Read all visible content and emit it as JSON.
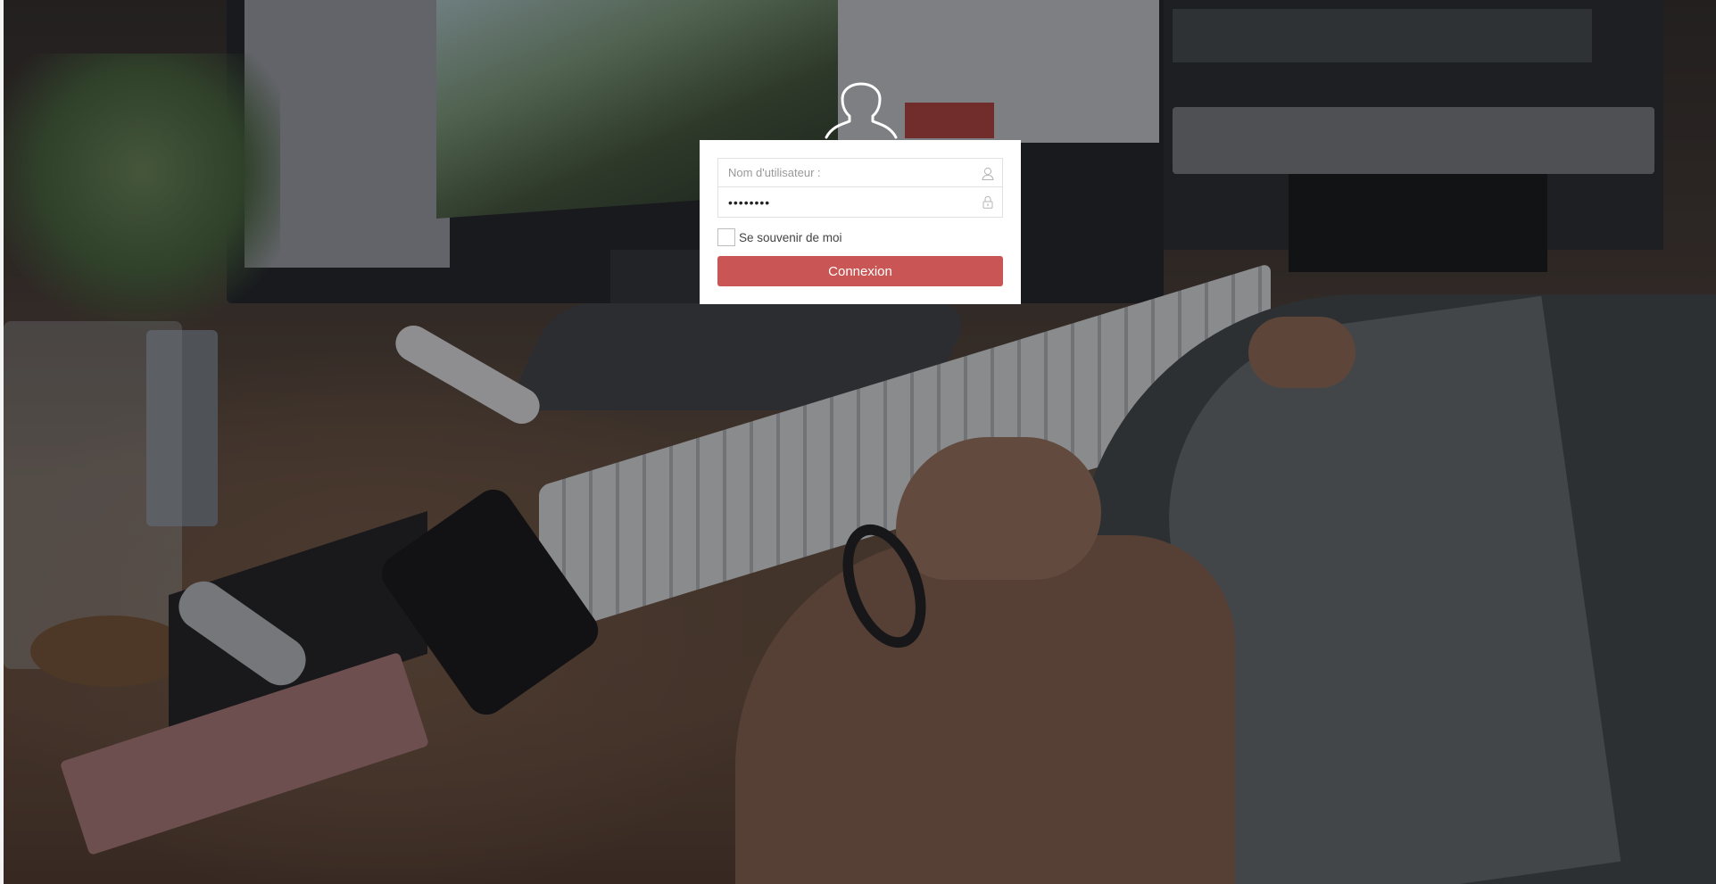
{
  "login": {
    "username_placeholder": "Nom d'utilisateur :",
    "password_value": "••••••••",
    "remember_label": "Se souvenir de moi",
    "remember_checked": false,
    "submit_label": "Connexion"
  },
  "icons": {
    "avatar": "user-silhouette-icon",
    "username_field": "user-icon",
    "password_field": "lock-icon"
  },
  "colors": {
    "primary_button": "#c95654",
    "card_background": "#ffffff"
  }
}
